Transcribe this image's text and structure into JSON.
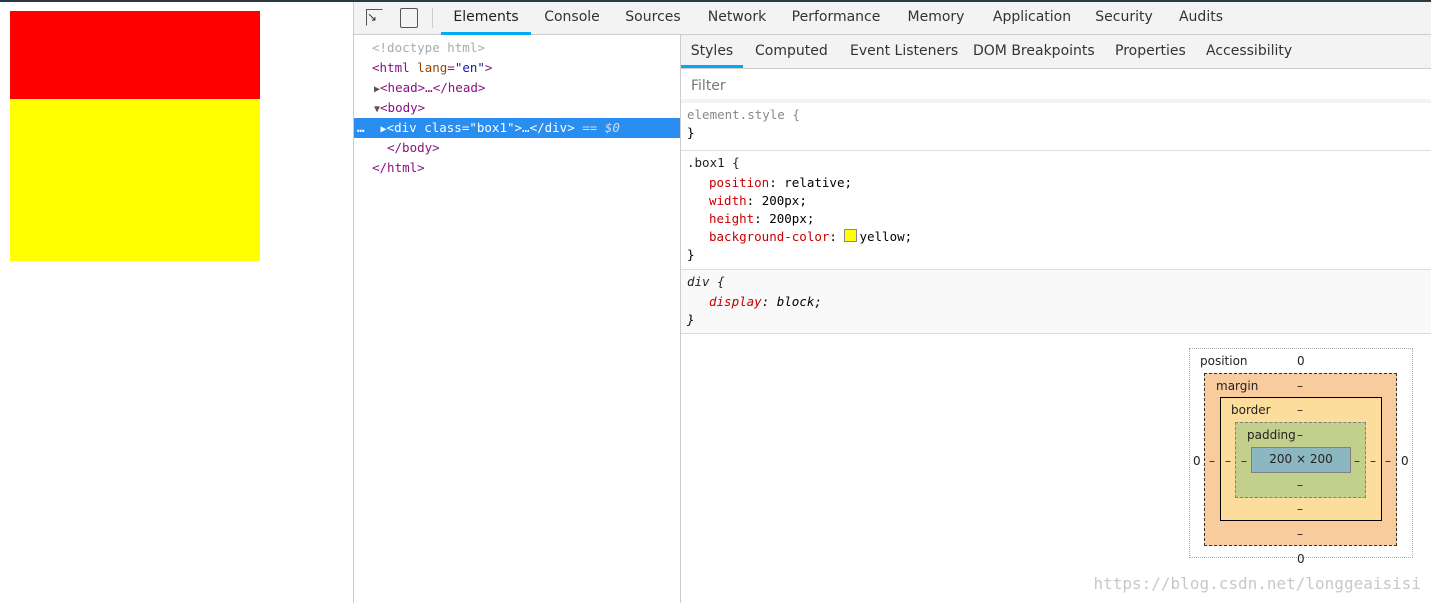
{
  "page": {
    "boxes": [
      {
        "name": "red-box",
        "color": "#ff0000"
      },
      {
        "name": "yellow-box",
        "color": "#ffff00"
      }
    ]
  },
  "toolbar": {
    "tabs": [
      "Elements",
      "Console",
      "Sources",
      "Network",
      "Performance",
      "Memory",
      "Application",
      "Security",
      "Audits"
    ],
    "active": "Elements"
  },
  "dom": {
    "doctype": "<!doctype html>",
    "html_open_tag": "<html",
    "html_attr": " lang",
    "html_eq": "=",
    "html_val": "\"en\"",
    "html_close_bracket": ">",
    "head": "<head>…</head>",
    "body_open": "<body>",
    "div_tag": "<div",
    "div_attr": " class",
    "div_val": "\"box1\"",
    "div_rest": ">…</div>",
    "selected_marker": "== $0",
    "body_close": "</body>",
    "html_close": "</html>",
    "dots": "…"
  },
  "styles": {
    "tabs": [
      "Styles",
      "Computed",
      "Event Listeners",
      "DOM Breakpoints",
      "Properties",
      "Accessibility"
    ],
    "active": "Styles",
    "filter_placeholder": "Filter",
    "rules": {
      "element_style": "element.style {",
      "close": "}",
      "box1_selector": ".box1 {",
      "box1_props": [
        {
          "name": "position",
          "value": "relative;"
        },
        {
          "name": "width",
          "value": "200px;"
        },
        {
          "name": "height",
          "value": "200px;"
        },
        {
          "name": "background-color",
          "value": "yellow;"
        }
      ],
      "div_selector": "div {",
      "div_prop": "display",
      "div_value": "block;"
    },
    "swatch_color": "#ffff00"
  },
  "box_model": {
    "position_label": "position",
    "position_top": "0",
    "position_left": "0",
    "position_right": "0",
    "position_bottom": "0",
    "margin_label": "margin",
    "border_label": "border",
    "padding_label": "padding",
    "dash": "–",
    "content": "200 × 200"
  },
  "watermark": "https://blog.csdn.net/longgeaisisi"
}
